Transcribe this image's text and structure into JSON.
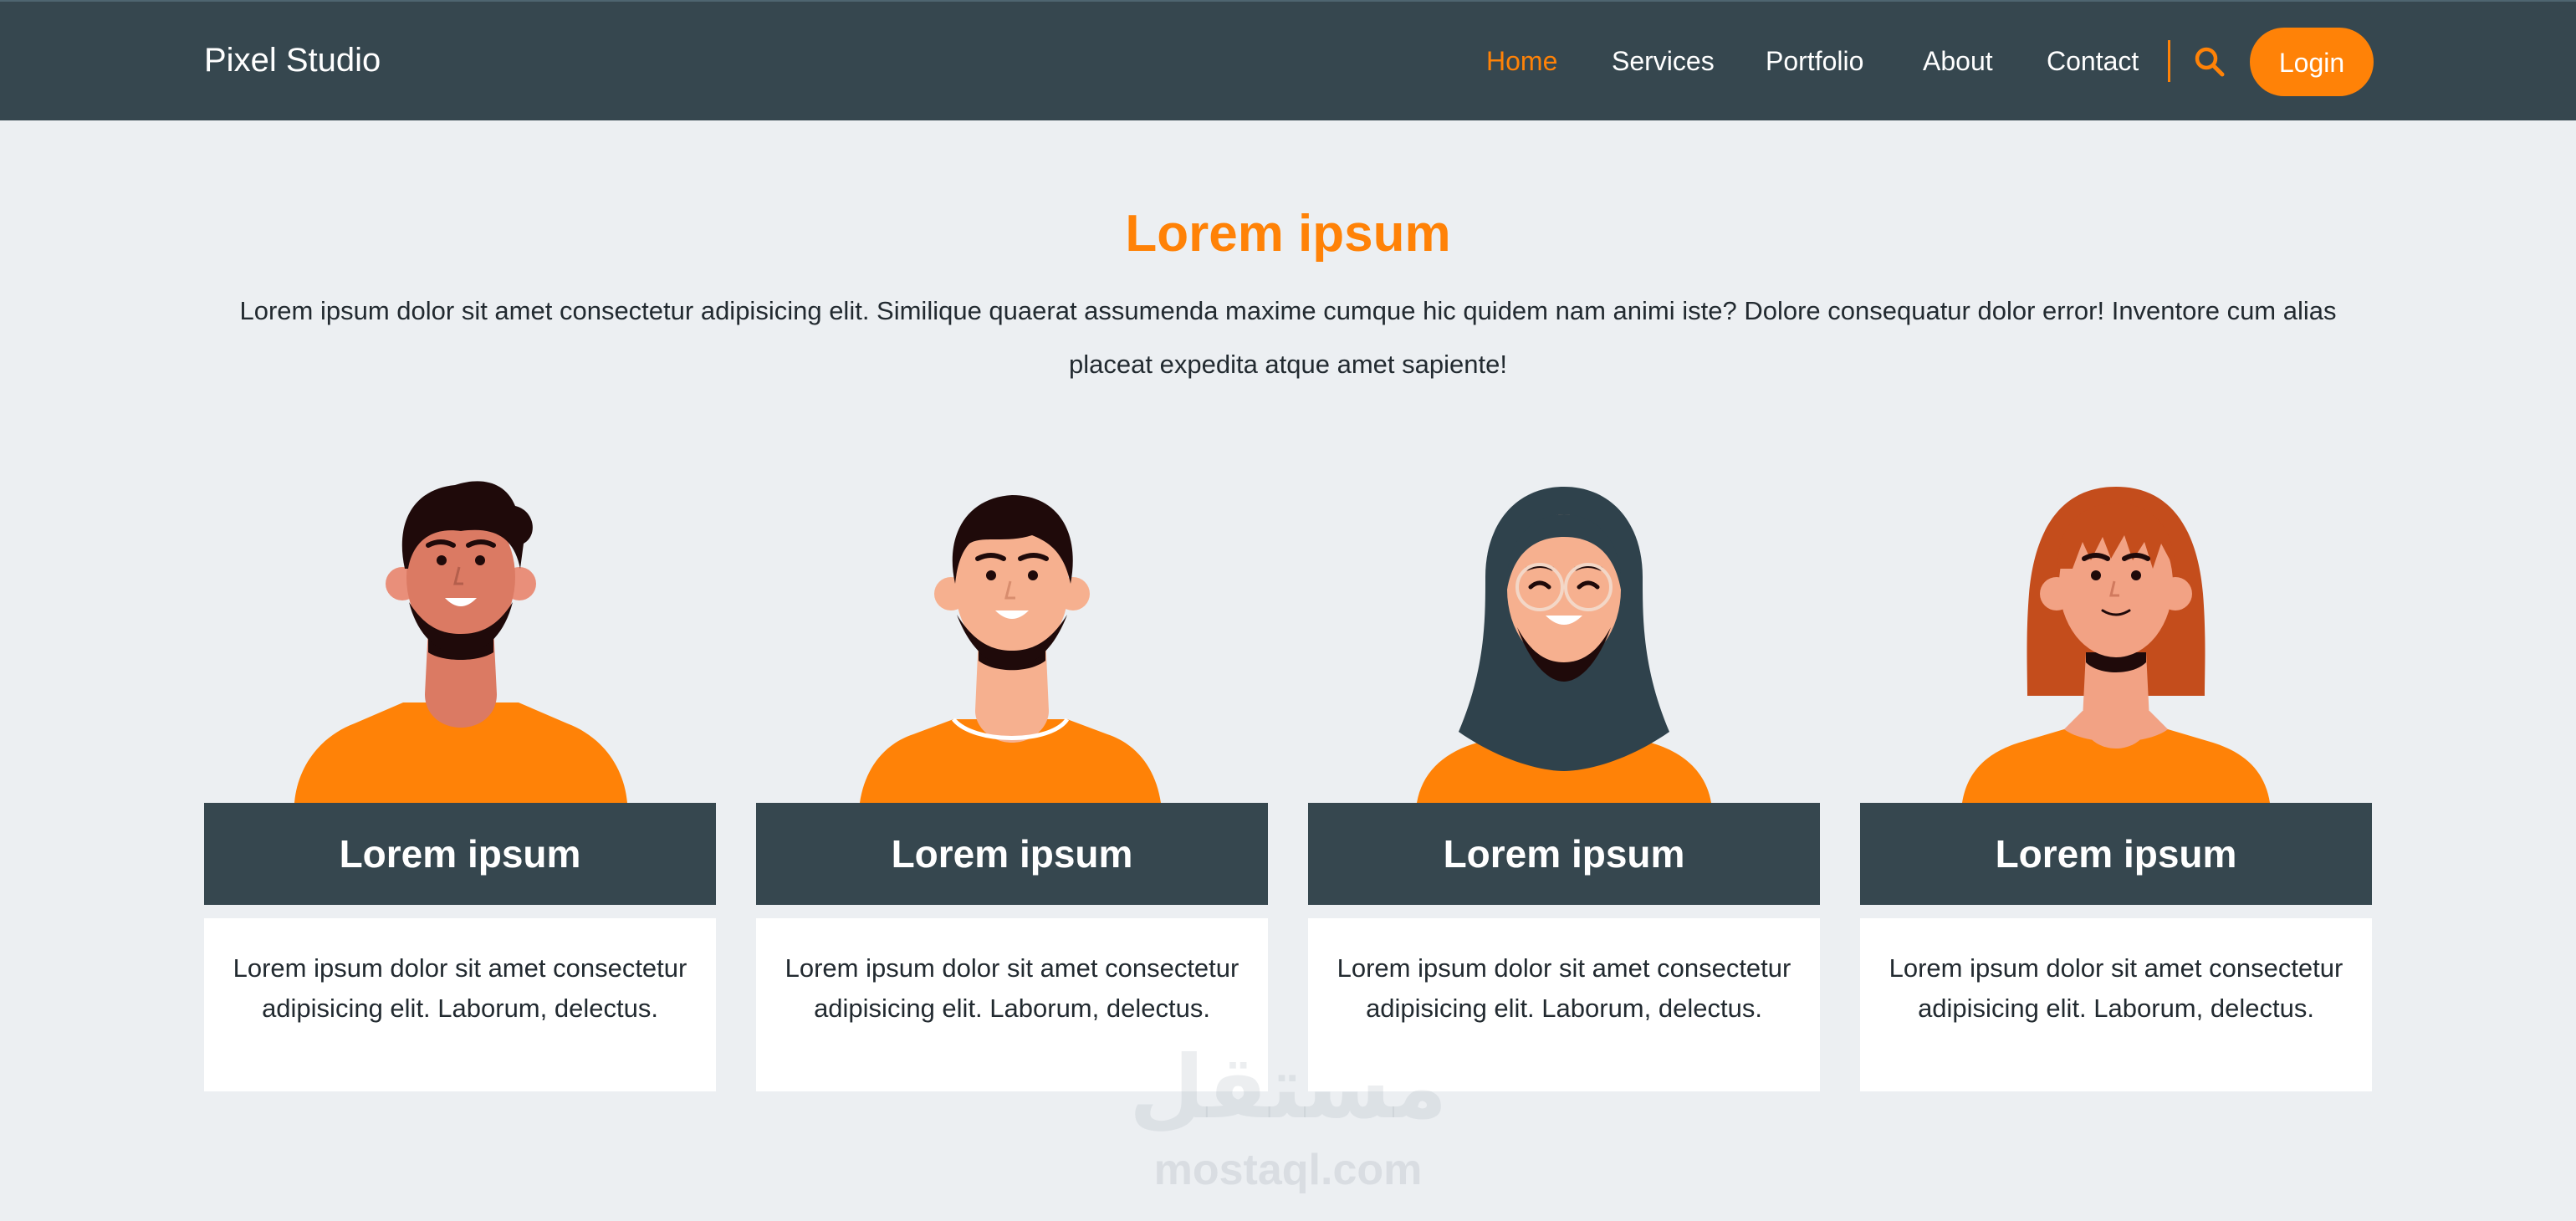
{
  "navbar": {
    "brand": "Pixel Studio",
    "links": [
      {
        "label": "Home",
        "active": true
      },
      {
        "label": "Services",
        "active": false
      },
      {
        "label": "Portfolio",
        "active": false
      },
      {
        "label": "About",
        "active": false
      },
      {
        "label": "Contact",
        "active": false
      }
    ],
    "search_icon": "search-icon",
    "login_label": "Login"
  },
  "hero": {
    "title": "Lorem ipsum",
    "text": "Lorem ipsum dolor sit amet consectetur adipisicing elit. Similique quaerat assumenda maxime cumque hic quidem nam animi iste? Dolore consequatur dolor error! Inventore cum alias placeat expedita atque amet sapiente!"
  },
  "cards": [
    {
      "avatar": "man-curly-hair-avatar",
      "title": "Lorem ipsum",
      "text": "Lorem ipsum dolor sit amet consectetur adipisicing elit. Laborum, delectus."
    },
    {
      "avatar": "man-short-hair-avatar",
      "title": "Lorem ipsum",
      "text": "Lorem ipsum dolor sit amet consectetur adipisicing elit. Laborum, delectus."
    },
    {
      "avatar": "woman-hijab-glasses-avatar",
      "title": "Lorem ipsum",
      "text": "Lorem ipsum dolor sit amet consectetur adipisicing elit. Laborum, delectus."
    },
    {
      "avatar": "woman-red-hair-avatar",
      "title": "Lorem ipsum",
      "text": "Lorem ipsum dolor sit amet consectetur adipisicing elit. Laborum, delectus."
    }
  ],
  "watermark": {
    "arabic": "مستقل",
    "latin": "mostaql.com"
  },
  "colors": {
    "navbar_bg": "#36474f",
    "accent": "#ff8207",
    "page_bg": "#eceff2",
    "card_title_bg": "#36474f",
    "card_body_bg": "#ffffff"
  }
}
